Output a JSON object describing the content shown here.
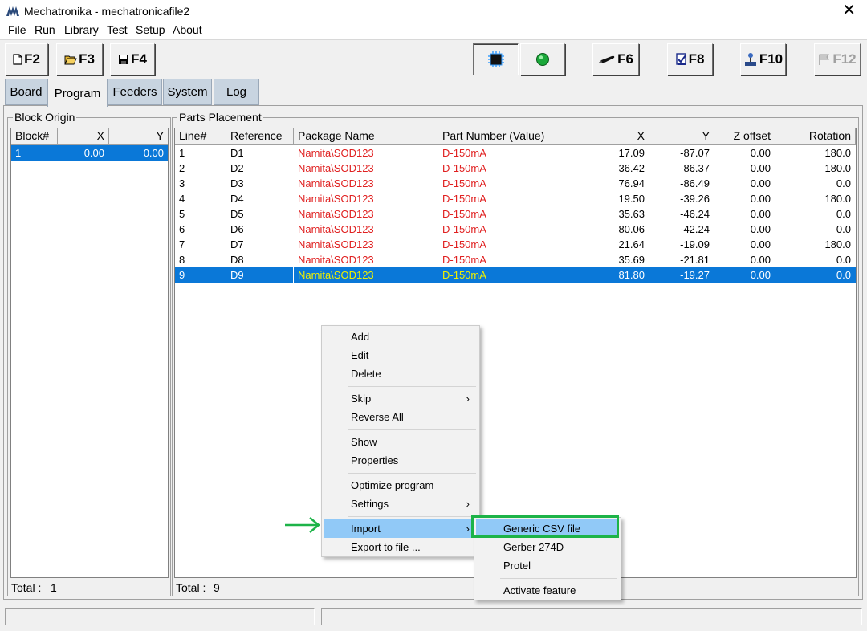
{
  "window": {
    "title": "Mechatronika - mechatronicafile2",
    "close": "✕"
  },
  "menu": [
    "File",
    "Run",
    "Library",
    "Test",
    "Setup",
    "About"
  ],
  "toolbar": {
    "f2": "F2",
    "f3": "F3",
    "f4": "F4",
    "f6": "F6",
    "f8": "F8",
    "f10": "F10",
    "f12": "F12"
  },
  "tabs": [
    "Board",
    "Program",
    "Feeders",
    "System",
    "Log"
  ],
  "block_origin": {
    "title": "Block Origin",
    "columns": [
      "Block#",
      "X",
      "Y"
    ],
    "rows": [
      {
        "block": "1",
        "x": "0.00",
        "y": "0.00"
      }
    ],
    "total_label": "Total :",
    "total_value": "1"
  },
  "parts_placement": {
    "title": "Parts Placement",
    "columns": [
      "Line#",
      "Reference",
      "Package Name",
      "Part Number (Value)",
      "X",
      "Y",
      "Z offset",
      "Rotation"
    ],
    "rows": [
      {
        "line": "1",
        "ref": "D1",
        "pkg": "Namita\\SOD123",
        "part": "D-150mA",
        "x": "17.09",
        "y": "-87.07",
        "z": "0.00",
        "rot": "180.0"
      },
      {
        "line": "2",
        "ref": "D2",
        "pkg": "Namita\\SOD123",
        "part": "D-150mA",
        "x": "36.42",
        "y": "-86.37",
        "z": "0.00",
        "rot": "180.0"
      },
      {
        "line": "3",
        "ref": "D3",
        "pkg": "Namita\\SOD123",
        "part": "D-150mA",
        "x": "76.94",
        "y": "-86.49",
        "z": "0.00",
        "rot": "0.0"
      },
      {
        "line": "4",
        "ref": "D4",
        "pkg": "Namita\\SOD123",
        "part": "D-150mA",
        "x": "19.50",
        "y": "-39.26",
        "z": "0.00",
        "rot": "180.0"
      },
      {
        "line": "5",
        "ref": "D5",
        "pkg": "Namita\\SOD123",
        "part": "D-150mA",
        "x": "35.63",
        "y": "-46.24",
        "z": "0.00",
        "rot": "0.0"
      },
      {
        "line": "6",
        "ref": "D6",
        "pkg": "Namita\\SOD123",
        "part": "D-150mA",
        "x": "80.06",
        "y": "-42.24",
        "z": "0.00",
        "rot": "0.0"
      },
      {
        "line": "7",
        "ref": "D7",
        "pkg": "Namita\\SOD123",
        "part": "D-150mA",
        "x": "21.64",
        "y": "-19.09",
        "z": "0.00",
        "rot": "180.0"
      },
      {
        "line": "8",
        "ref": "D8",
        "pkg": "Namita\\SOD123",
        "part": "D-150mA",
        "x": "35.69",
        "y": "-21.81",
        "z": "0.00",
        "rot": "0.0"
      },
      {
        "line": "9",
        "ref": "D9",
        "pkg": "Namita\\SOD123",
        "part": "D-150mA",
        "x": "81.80",
        "y": "-19.27",
        "z": "0.00",
        "rot": "0.0"
      }
    ],
    "selected_line": "9",
    "total_label": "Total :",
    "total_value": "9"
  },
  "context_menu": {
    "items": [
      "Add",
      "Edit",
      "Delete",
      "Skip",
      "Reverse All",
      "Show",
      "Properties",
      "Optimize program",
      "Settings",
      "Import",
      "Export to file ..."
    ],
    "highlighted": "Import"
  },
  "import_submenu": {
    "items": [
      "Generic CSV file",
      "Gerber 274D",
      "Protel",
      "Activate feature"
    ],
    "highlighted": "Generic CSV file"
  },
  "colors": {
    "selection": "#0a78d8",
    "part_text": "#e02020",
    "annotation": "#1db348",
    "menu_highlight": "#91c9f7"
  },
  "icons": [
    "app-logo-icon",
    "new-file-icon",
    "open-folder-icon",
    "save-disk-icon",
    "chip-icon",
    "green-led-icon",
    "pen-icon",
    "check-icon",
    "joystick-icon",
    "flag-icon",
    "submenu-arrow-icon",
    "green-arrow-icon"
  ]
}
